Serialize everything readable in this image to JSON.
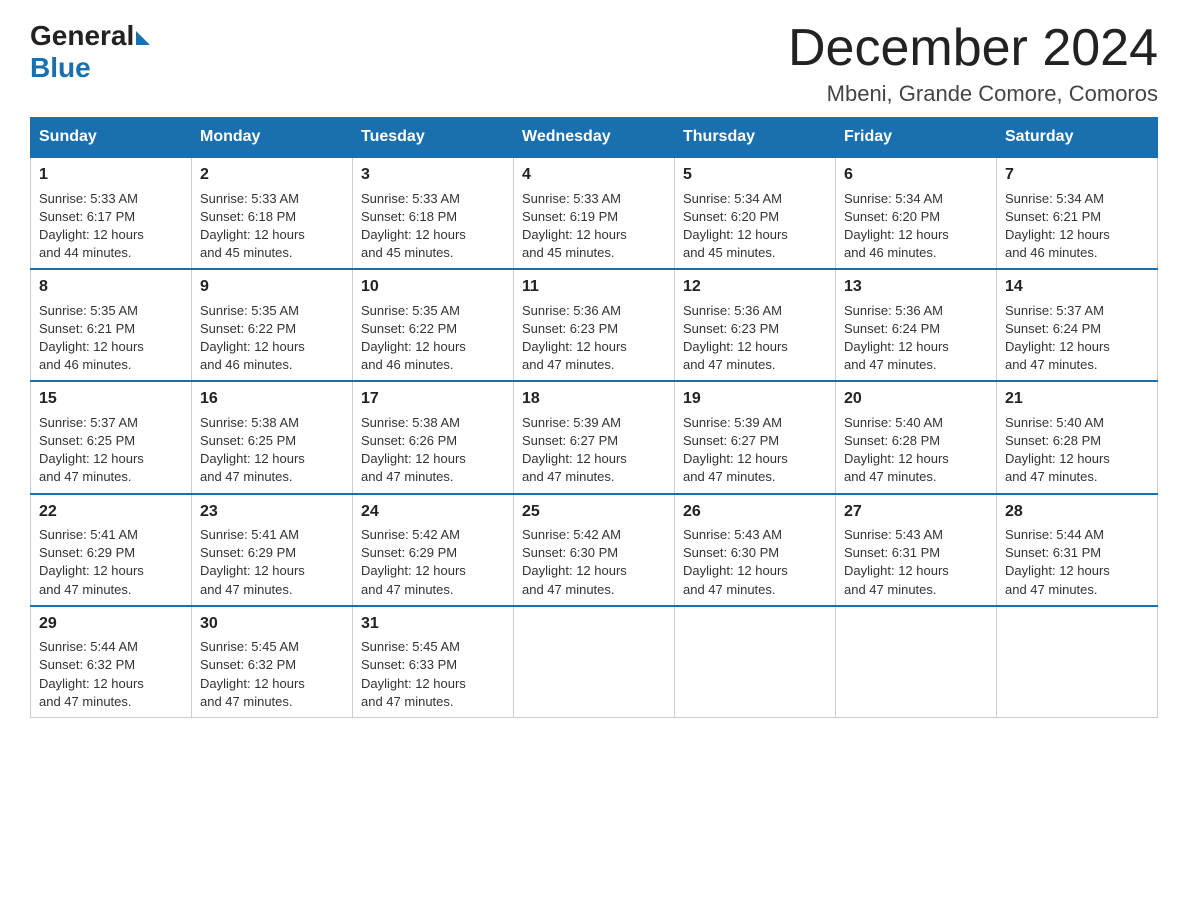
{
  "header": {
    "logo": {
      "general": "General",
      "blue": "Blue"
    },
    "title": "December 2024",
    "location": "Mbeni, Grande Comore, Comoros"
  },
  "days_of_week": [
    "Sunday",
    "Monday",
    "Tuesday",
    "Wednesday",
    "Thursday",
    "Friday",
    "Saturday"
  ],
  "weeks": [
    [
      {
        "day": "1",
        "sunrise": "5:33 AM",
        "sunset": "6:17 PM",
        "daylight": "12 hours and 44 minutes."
      },
      {
        "day": "2",
        "sunrise": "5:33 AM",
        "sunset": "6:18 PM",
        "daylight": "12 hours and 45 minutes."
      },
      {
        "day": "3",
        "sunrise": "5:33 AM",
        "sunset": "6:18 PM",
        "daylight": "12 hours and 45 minutes."
      },
      {
        "day": "4",
        "sunrise": "5:33 AM",
        "sunset": "6:19 PM",
        "daylight": "12 hours and 45 minutes."
      },
      {
        "day": "5",
        "sunrise": "5:34 AM",
        "sunset": "6:20 PM",
        "daylight": "12 hours and 45 minutes."
      },
      {
        "day": "6",
        "sunrise": "5:34 AM",
        "sunset": "6:20 PM",
        "daylight": "12 hours and 46 minutes."
      },
      {
        "day": "7",
        "sunrise": "5:34 AM",
        "sunset": "6:21 PM",
        "daylight": "12 hours and 46 minutes."
      }
    ],
    [
      {
        "day": "8",
        "sunrise": "5:35 AM",
        "sunset": "6:21 PM",
        "daylight": "12 hours and 46 minutes."
      },
      {
        "day": "9",
        "sunrise": "5:35 AM",
        "sunset": "6:22 PM",
        "daylight": "12 hours and 46 minutes."
      },
      {
        "day": "10",
        "sunrise": "5:35 AM",
        "sunset": "6:22 PM",
        "daylight": "12 hours and 46 minutes."
      },
      {
        "day": "11",
        "sunrise": "5:36 AM",
        "sunset": "6:23 PM",
        "daylight": "12 hours and 47 minutes."
      },
      {
        "day": "12",
        "sunrise": "5:36 AM",
        "sunset": "6:23 PM",
        "daylight": "12 hours and 47 minutes."
      },
      {
        "day": "13",
        "sunrise": "5:36 AM",
        "sunset": "6:24 PM",
        "daylight": "12 hours and 47 minutes."
      },
      {
        "day": "14",
        "sunrise": "5:37 AM",
        "sunset": "6:24 PM",
        "daylight": "12 hours and 47 minutes."
      }
    ],
    [
      {
        "day": "15",
        "sunrise": "5:37 AM",
        "sunset": "6:25 PM",
        "daylight": "12 hours and 47 minutes."
      },
      {
        "day": "16",
        "sunrise": "5:38 AM",
        "sunset": "6:25 PM",
        "daylight": "12 hours and 47 minutes."
      },
      {
        "day": "17",
        "sunrise": "5:38 AM",
        "sunset": "6:26 PM",
        "daylight": "12 hours and 47 minutes."
      },
      {
        "day": "18",
        "sunrise": "5:39 AM",
        "sunset": "6:27 PM",
        "daylight": "12 hours and 47 minutes."
      },
      {
        "day": "19",
        "sunrise": "5:39 AM",
        "sunset": "6:27 PM",
        "daylight": "12 hours and 47 minutes."
      },
      {
        "day": "20",
        "sunrise": "5:40 AM",
        "sunset": "6:28 PM",
        "daylight": "12 hours and 47 minutes."
      },
      {
        "day": "21",
        "sunrise": "5:40 AM",
        "sunset": "6:28 PM",
        "daylight": "12 hours and 47 minutes."
      }
    ],
    [
      {
        "day": "22",
        "sunrise": "5:41 AM",
        "sunset": "6:29 PM",
        "daylight": "12 hours and 47 minutes."
      },
      {
        "day": "23",
        "sunrise": "5:41 AM",
        "sunset": "6:29 PM",
        "daylight": "12 hours and 47 minutes."
      },
      {
        "day": "24",
        "sunrise": "5:42 AM",
        "sunset": "6:29 PM",
        "daylight": "12 hours and 47 minutes."
      },
      {
        "day": "25",
        "sunrise": "5:42 AM",
        "sunset": "6:30 PM",
        "daylight": "12 hours and 47 minutes."
      },
      {
        "day": "26",
        "sunrise": "5:43 AM",
        "sunset": "6:30 PM",
        "daylight": "12 hours and 47 minutes."
      },
      {
        "day": "27",
        "sunrise": "5:43 AM",
        "sunset": "6:31 PM",
        "daylight": "12 hours and 47 minutes."
      },
      {
        "day": "28",
        "sunrise": "5:44 AM",
        "sunset": "6:31 PM",
        "daylight": "12 hours and 47 minutes."
      }
    ],
    [
      {
        "day": "29",
        "sunrise": "5:44 AM",
        "sunset": "6:32 PM",
        "daylight": "12 hours and 47 minutes."
      },
      {
        "day": "30",
        "sunrise": "5:45 AM",
        "sunset": "6:32 PM",
        "daylight": "12 hours and 47 minutes."
      },
      {
        "day": "31",
        "sunrise": "5:45 AM",
        "sunset": "6:33 PM",
        "daylight": "12 hours and 47 minutes."
      },
      null,
      null,
      null,
      null
    ]
  ],
  "labels": {
    "sunrise": "Sunrise:",
    "sunset": "Sunset:",
    "daylight": "Daylight:"
  }
}
